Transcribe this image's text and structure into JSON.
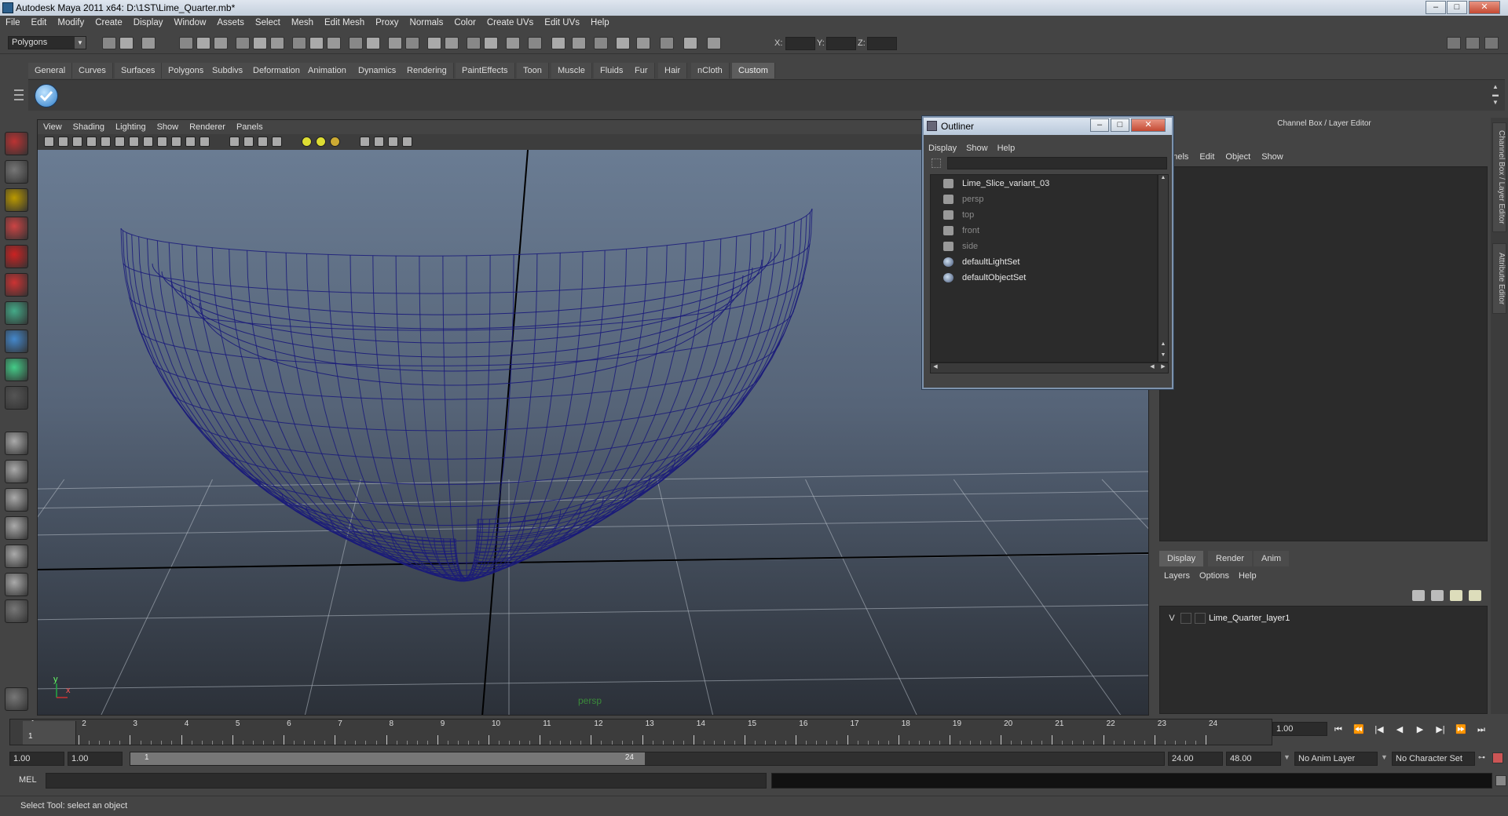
{
  "window": {
    "title": "Autodesk Maya 2011 x64: D:\\1ST\\Lime_Quarter.mb*",
    "buttons": [
      "–",
      "□",
      "✕"
    ]
  },
  "menubar": [
    "File",
    "Edit",
    "Modify",
    "Create",
    "Display",
    "Window",
    "Assets",
    "Select",
    "Mesh",
    "Edit Mesh",
    "Proxy",
    "Normals",
    "Color",
    "Create UVs",
    "Edit UVs",
    "Help"
  ],
  "statusline": {
    "mode": "Polygons",
    "x_label": "X:",
    "y_label": "Y:",
    "z_label": "Z:"
  },
  "shelf": {
    "tabs": [
      "General",
      "Curves",
      "Surfaces",
      "Polygons",
      "Subdivs",
      "Deformation",
      "Animation",
      "Dynamics",
      "Rendering",
      "PaintEffects",
      "Toon",
      "Muscle",
      "Fluids",
      "Fur",
      "Hair",
      "nCloth",
      "Custom"
    ],
    "active_tab": "Custom"
  },
  "viewport": {
    "menu": [
      "View",
      "Shading",
      "Lighting",
      "Show",
      "Renderer",
      "Panels"
    ],
    "camera_label": "persp",
    "axis_y": "y",
    "axis_x": "x",
    "wire_color": "#1a1a7a"
  },
  "outliner": {
    "title": "Outliner",
    "menu": [
      "Display",
      "Show",
      "Help"
    ],
    "items": [
      {
        "label": "Lime_Slice_variant_03",
        "dim": false,
        "icon": "mesh-icon"
      },
      {
        "label": "persp",
        "dim": true,
        "icon": "camera-icon"
      },
      {
        "label": "top",
        "dim": true,
        "icon": "camera-icon"
      },
      {
        "label": "front",
        "dim": true,
        "icon": "camera-icon"
      },
      {
        "label": "side",
        "dim": true,
        "icon": "camera-icon"
      },
      {
        "label": "defaultLightSet",
        "dim": false,
        "icon": "set-icon"
      },
      {
        "label": "defaultObjectSet",
        "dim": false,
        "icon": "set-icon"
      }
    ]
  },
  "channelbox": {
    "header": "Channel Box / Layer Editor",
    "menu": [
      "annels",
      "Edit",
      "Object",
      "Show"
    ],
    "side_tabs": [
      "Channel Box / Layer Editor",
      "Attribute Editor"
    ]
  },
  "layers": {
    "tabs": [
      "Display",
      "Render",
      "Anim"
    ],
    "active_tab": "Display",
    "menu": [
      "Layers",
      "Options",
      "Help"
    ],
    "items": [
      {
        "visible": "V",
        "name": "Lime_Quarter_layer1"
      }
    ]
  },
  "timeline": {
    "start": 1,
    "end": 24,
    "current_frame": "1.00",
    "labels": [
      "1",
      "2",
      "3",
      "4",
      "5",
      "6",
      "7",
      "8",
      "9",
      "10",
      "11",
      "12",
      "13",
      "14",
      "15",
      "16",
      "17",
      "18",
      "19",
      "20",
      "21",
      "22",
      "23",
      "24"
    ],
    "marker": "1"
  },
  "range": {
    "start_time": "1.00",
    "playback_start": "1.00",
    "range_start_label": "1",
    "range_end_label": "24",
    "playback_end": "24.00",
    "end_time": "48.00",
    "anim_layer": "No Anim Layer",
    "character_set": "No Character Set"
  },
  "commandline": {
    "label": "MEL"
  },
  "helpline": {
    "text": "Select Tool: select an object"
  }
}
